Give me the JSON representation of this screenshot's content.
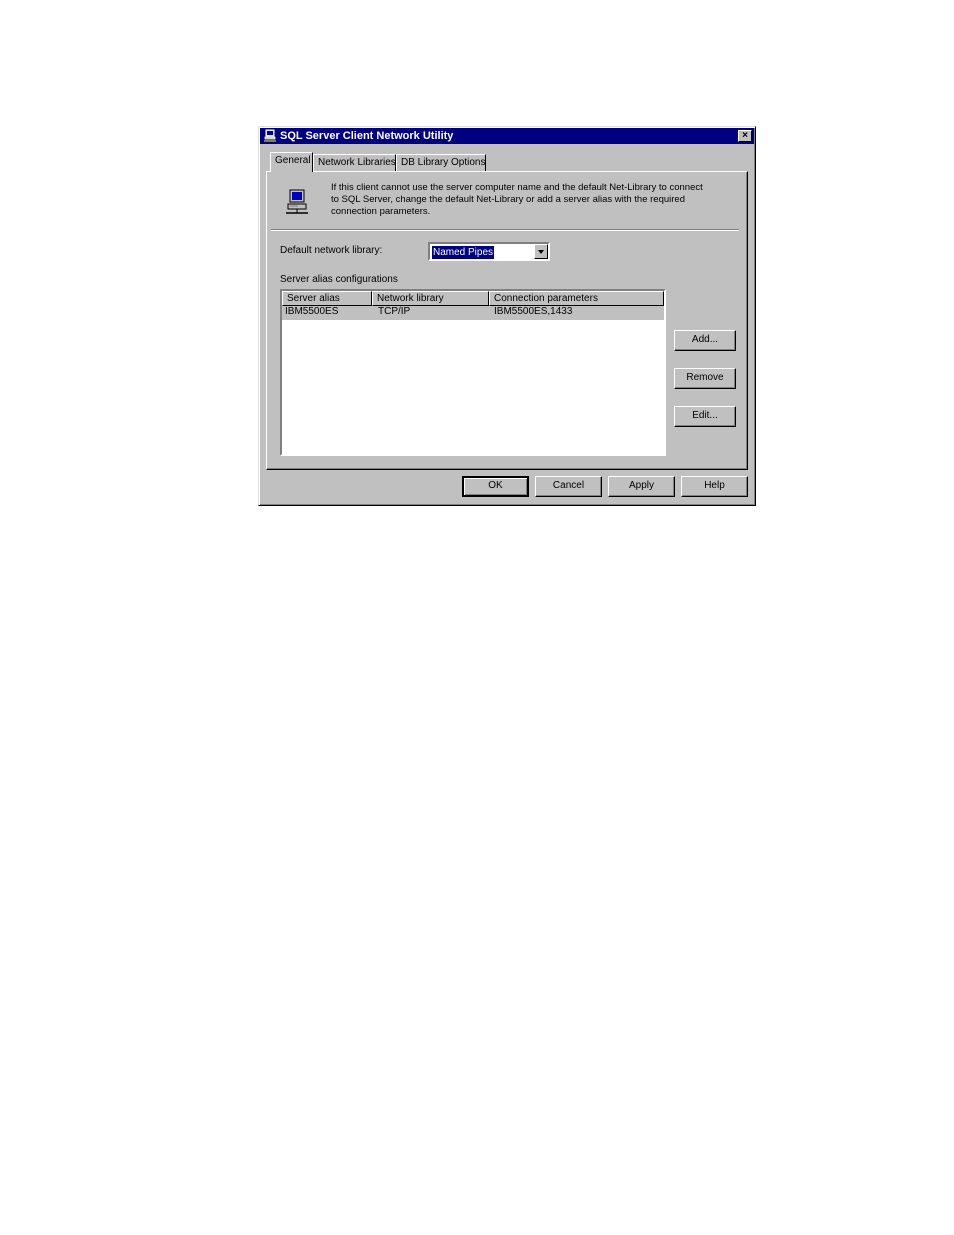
{
  "window": {
    "title": "SQL Server Client Network Utility",
    "close_glyph": "×"
  },
  "tabs": [
    {
      "label": "General",
      "active": true
    },
    {
      "label": "Network Libraries",
      "active": false
    },
    {
      "label": "DB Library Options",
      "active": false
    }
  ],
  "info": {
    "icon": "network-computer-icon",
    "lines": [
      "If this client cannot use the server computer name and the default Net-Library to connect",
      "to SQL Server, change the default Net-Library or add a server alias with the required",
      "connection parameters."
    ]
  },
  "default_library": {
    "label": "Default network library:",
    "value": "Named Pipes"
  },
  "alias_section": {
    "label": "Server alias configurations",
    "columns": [
      "Server alias",
      "Network library",
      "Connection parameters"
    ],
    "rows": [
      {
        "alias": "IBM5500ES",
        "library": "TCP/IP",
        "params": "IBM5500ES,1433"
      }
    ]
  },
  "side_buttons": {
    "add": "Add...",
    "remove": "Remove",
    "edit": "Edit..."
  },
  "footer_buttons": {
    "ok": "OK",
    "cancel": "Cancel",
    "apply": "Apply",
    "help": "Help"
  },
  "colors": {
    "titlebar": "#000080",
    "face": "#c0c0c0",
    "selection": "#000080"
  }
}
